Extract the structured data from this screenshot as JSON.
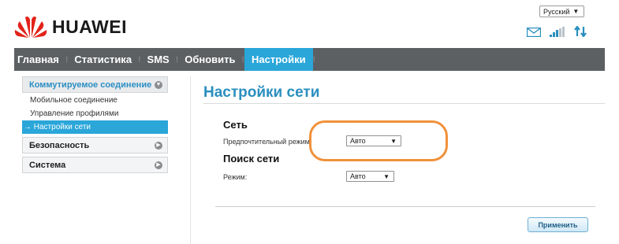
{
  "brand": {
    "name": "HUAWEI",
    "logo_color": "#e2231a"
  },
  "language": {
    "selected": "Русский"
  },
  "status_icons": [
    "mail-icon",
    "signal-strength-icon",
    "data-transfer-icon"
  ],
  "nav": {
    "items": [
      "Главная",
      "Статистика",
      "SMS",
      "Обновить",
      "Настройки"
    ],
    "active": "Настройки",
    "bg_color": "#5d6063",
    "active_color": "#2aa6d9"
  },
  "sidebar": {
    "groups": [
      {
        "label": "Коммутируемое соединение",
        "items": [
          "Мобильное соединение",
          "Управление профилями",
          "→ Настройки сети"
        ]
      },
      {
        "label": "Безопасность"
      },
      {
        "label": "Система"
      }
    ]
  },
  "main": {
    "title": "Настройки сети",
    "network": {
      "heading": "Сеть",
      "preferred_mode_label": "Предпочтительный режим:",
      "preferred_mode_value": "Авто"
    },
    "search": {
      "heading": "Поиск сети",
      "mode_label": "Режим:",
      "mode_value": "Авто"
    },
    "apply_label": "Применить",
    "highlight_color": "#f0913a"
  }
}
